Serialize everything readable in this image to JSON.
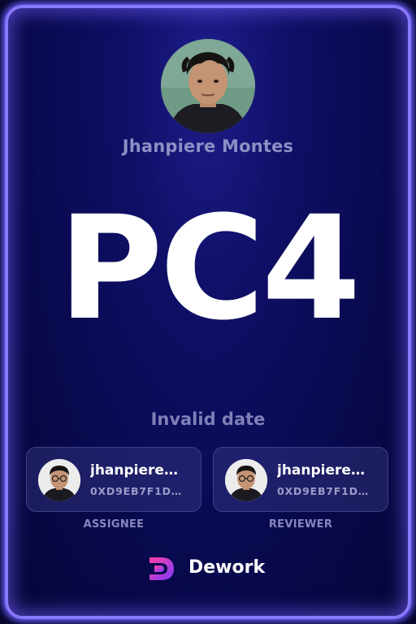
{
  "owner": {
    "name": "Jhanpiere Montes",
    "avatar_icon": "user-photo-avatar"
  },
  "task": {
    "title": "PC4",
    "date": "Invalid date"
  },
  "assignee": {
    "name": "jhanpiere…",
    "address": "0XD9EB7F1D…",
    "role": "ASSIGNEE",
    "avatar_icon": "user-photo-avatar"
  },
  "reviewer": {
    "name": "jhanpiere…",
    "address": "0XD9EB7F1D…",
    "role": "REVIEWER",
    "avatar_icon": "user-photo-avatar"
  },
  "brand": {
    "name": "Dework",
    "logo_icon": "dework-logo-icon"
  },
  "colors": {
    "card_border": "#8a78ff",
    "background": "#0f0f66",
    "accent_gradient_start": "#ff3ea5",
    "accent_gradient_end": "#7a3cff"
  }
}
